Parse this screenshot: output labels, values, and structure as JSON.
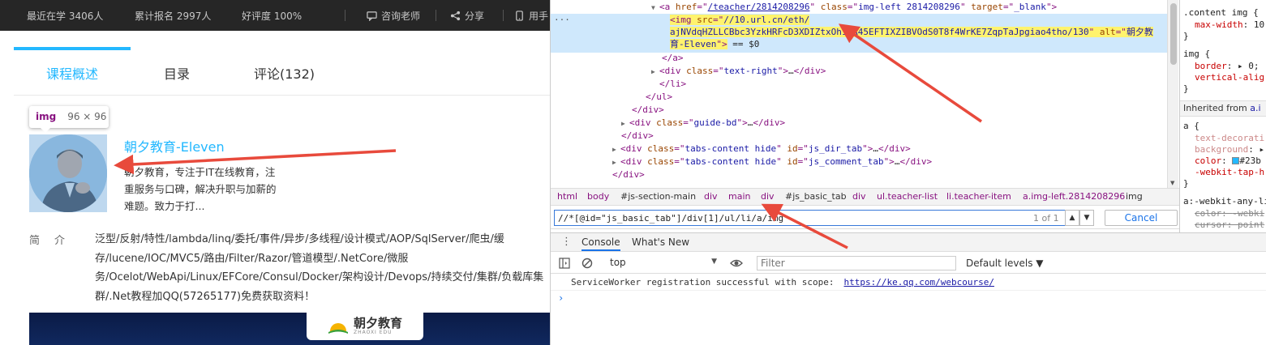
{
  "topbar": {
    "stats": [
      "最近在学  3406人",
      "累计报名  2997人",
      "好评度  100%"
    ],
    "consult": "咨询老师",
    "share": "分享",
    "mobile": "用手"
  },
  "tabs": [
    "课程概述",
    "目录",
    "评论(132)"
  ],
  "tooltip": {
    "tag": "img",
    "size": "96 × 96"
  },
  "teacher": {
    "name": "朝夕教育-Eleven",
    "desc": "朝夕教育，专注于IT在线教育，注重服务与口碑，解决升职与加薪的难题。致力于打..."
  },
  "intro": {
    "label": "简介",
    "text": "泛型/反射/特性/lambda/linq/委托/事件/异步/多线程/设计模式/AOP/SqlServer/爬虫/缓存/lucene/IOC/MVC5/路由/Filter/Razor/管道模型/.NetCore/微服务/Ocelot/WebApi/Linux/EFCore/Consul/Docker/架构设计/Devops/持续交付/集群/负载库集群/.Net教程加QQ(57265177)免费获取资料！"
  },
  "banner": {
    "brand": "朝夕教育",
    "sub": "ZHAOXI EDU"
  },
  "dom": {
    "line1": {
      "tag": "a",
      "attrs": [
        [
          "href",
          "/teacher/2814208296"
        ],
        [
          "class",
          "img-left 2814208296"
        ],
        [
          "target",
          "_blank"
        ]
      ]
    },
    "img_src_1": "//10.url.cn/eth/",
    "img_src_2": "ajNVdqHZLLCBbc3YzkHRFcD3XDIZtxOh1",
    "img_src_3": "GA45EFTIXZIBVOdS0T8f4WrKE7ZqpTaJpgiao4tho/130",
    "img_alt_1": "朝夕教",
    "img_alt_2": "育-Eleven",
    "dollar": "== $0",
    "close_a": "</a>",
    "text_right": "text-right",
    "close_li": "</li>",
    "close_ul": "</ul>",
    "close_div": "</div>",
    "guide_bd": "guide-bd",
    "tabs_content": "tabs-content hide",
    "dir_tab": "js_dir_tab",
    "comment_tab": "js_comment_tab",
    "ellipsis": "…"
  },
  "crumbs": [
    "html",
    "body",
    "#js-section-main",
    "div",
    "main",
    "div",
    "#js_basic_tab",
    "div",
    "ul.teacher-list",
    "li.teacher-item",
    "a.img-left.2814208296",
    "img"
  ],
  "search": {
    "value": "//*[@id=\"js_basic_tab\"]/div[1]/ul/li/a/img",
    "count": "1 of 1",
    "cancel": "Cancel"
  },
  "drawer": {
    "tabs": [
      "Console",
      "What's New"
    ]
  },
  "console": {
    "context": "top",
    "filter_placeholder": "Filter",
    "levels": "Default levels ▼",
    "log": "ServiceWorker registration successful with scope:",
    "log_link": "https://ke.qq.com/webcourse/"
  },
  "styles": {
    "rule1_sel": ".content img {",
    "rule1_prop": "max-width",
    "rule1_val": "10",
    "rule2_sel": "img {",
    "rule2_p1": "border",
    "rule2_v1": "▸ 0;",
    "rule2_p2": "vertical-alig",
    "inherited_label": "Inherited from",
    "inherited_link": "a.i",
    "rule3_sel": "a {",
    "rule3_p1": "text-decorati",
    "rule3_p2": "background",
    "rule3_v2": "▸",
    "rule3_p3": "color",
    "rule3_v3": "#23b",
    "rule3_p4": "-webkit-tap-h",
    "rule4_sel": "a:-webkit-any-li",
    "rule4_p1": "color",
    "rule4_v1": "-webki",
    "rule4_p2": "cursor",
    "rule4_v2": "point",
    "close": "}"
  },
  "colors": {
    "accent": "#23b8ff",
    "arrow": "#e84a3c",
    "highlight": "#fff36d"
  }
}
